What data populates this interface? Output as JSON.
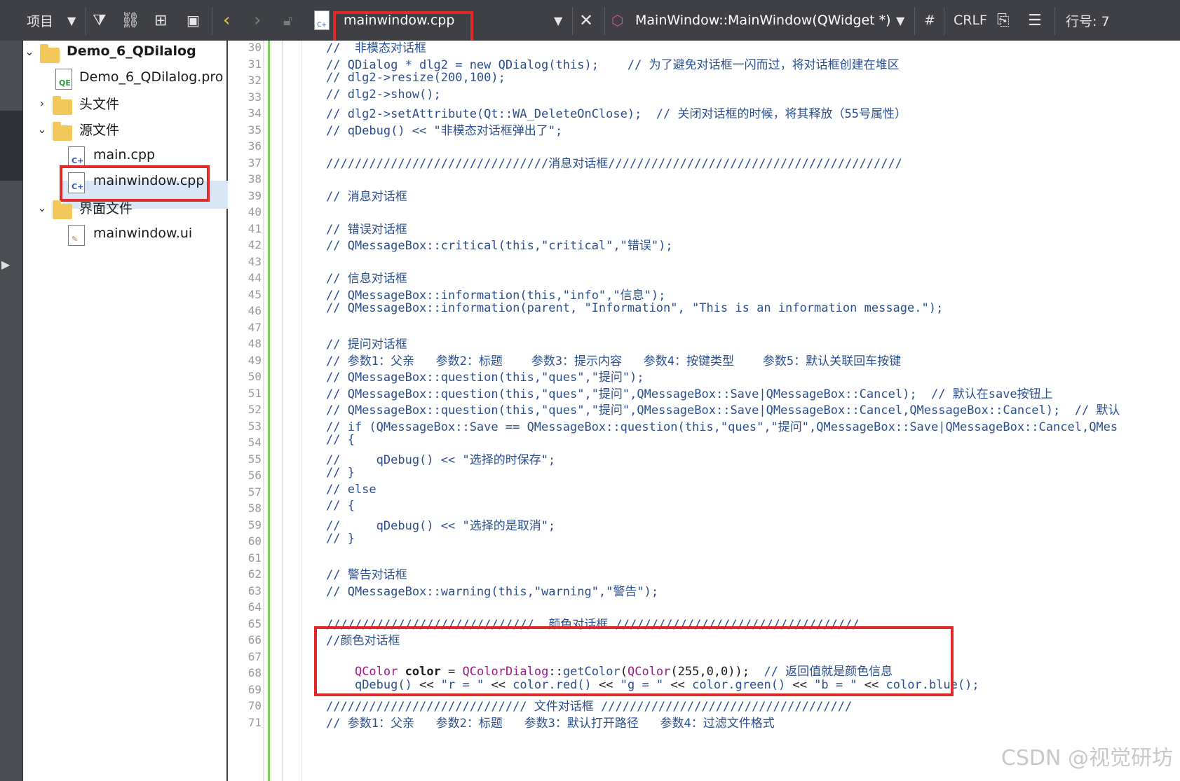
{
  "toolbar": {
    "project_label": "项目",
    "file_name": "mainwindow.cpp",
    "function_name": "MainWindow::MainWindow(QWidget *)",
    "hash": "#",
    "line_ending": "CRLF",
    "line_label": "行号: 7"
  },
  "tree": {
    "project": "Demo_6_QDilalog",
    "pro_file": "Demo_6_QDilalog.pro",
    "headers": "头文件",
    "sources": "源文件",
    "main_cpp": "main.cpp",
    "mainwindow_cpp": "mainwindow.cpp",
    "forms": "界面文件",
    "mainwindow_ui": "mainwindow.ui"
  },
  "editor": {
    "line_numbers": [
      "30",
      "31",
      "32",
      "33",
      "34",
      "35",
      "36",
      "37",
      "38",
      "39",
      "40",
      "41",
      "42",
      "43",
      "44",
      "45",
      "46",
      "47",
      "48",
      "49",
      "50",
      "51",
      "52",
      "53",
      "54",
      "55",
      "56",
      "57",
      "58",
      "59",
      "60",
      "61",
      "62",
      "63",
      "64",
      "65",
      "66",
      "67",
      "68",
      "69",
      "70",
      "71"
    ],
    "lines": [
      "//  非模态对话框",
      "// QDialog * dlg2 = new QDialog(this);    // 为了避免对话框一闪而过，将对话框创建在堆区",
      "// dlg2->resize(200,100);",
      "// dlg2->show();",
      "// dlg2->setAttribute(Qt::WA_DeleteOnClose);  // 关闭对话框的时候，将其释放（55号属性）",
      "// qDebug() << \"非模态对话框弹出了\";",
      "",
      "///////////////////////////////消息对话框/////////////////////////////////////////",
      "",
      "// 消息对话框",
      "",
      "// 错误对话框",
      "// QMessageBox::critical(this,\"critical\",\"错误\");",
      "",
      "// 信息对话框",
      "// QMessageBox::information(this,\"info\",\"信息\");",
      "// QMessageBox::information(parent, \"Information\", \"This is an information message.\");",
      "",
      "// 提问对话框",
      "// 参数1：父亲   参数2：标题    参数3：提示内容   参数4：按键类型    参数5：默认关联回车按键",
      "// QMessageBox::question(this,\"ques\",\"提问\");",
      "// QMessageBox::question(this,\"ques\",\"提问\",QMessageBox::Save|QMessageBox::Cancel);  // 默认在save按钮上",
      "// QMessageBox::question(this,\"ques\",\"提问\",QMessageBox::Save|QMessageBox::Cancel,QMessageBox::Cancel);  // 默认",
      "// if (QMessageBox::Save == QMessageBox::question(this,\"ques\",\"提问\",QMessageBox::Save|QMessageBox::Cancel,QMes",
      "// {",
      "//     qDebug() << \"选择的时保存\";",
      "// }",
      "// else",
      "// {",
      "//     qDebug() << \"选择的是取消\";",
      "// }",
      "",
      "// 警告对话框",
      "// QMessageBox::warning(this,\"warning\",\"警告\");",
      "",
      "/////////////////////////////  颜色对话框 //////////////////////////////////",
      "//颜色对话框",
      "",
      "",
      "",
      "//////////////////////////// 文件对话框 ///////////////////////////////////",
      "// 参数1：父亲   参数2：标题   参数3：默认打开路径   参数4：过滤文件格式"
    ],
    "color_line_1": {
      "type1": "QColor",
      "var": "color",
      "eq": " = ",
      "type2": "QColorDialog",
      "scope": "::",
      "func": "getColor",
      "paren1": "(",
      "type3": "QColor",
      "args": "(255,0,0));",
      "comment": "  // 返回值就是颜色信息"
    },
    "color_line_2": {
      "a": "qDebug()",
      "b": " << ",
      "c": "\"r = \"",
      "d": " << ",
      "e": "color",
      "f": ".red()",
      "g": " << ",
      "h": "\"g = \"",
      "i": " << ",
      "j": "color",
      "k": ".green()",
      "l": " << ",
      "m": "\"b = \"",
      "n": " << ",
      "o": "color",
      "p": ".blue();"
    }
  },
  "watermark": "CSDN @视觉研坊"
}
